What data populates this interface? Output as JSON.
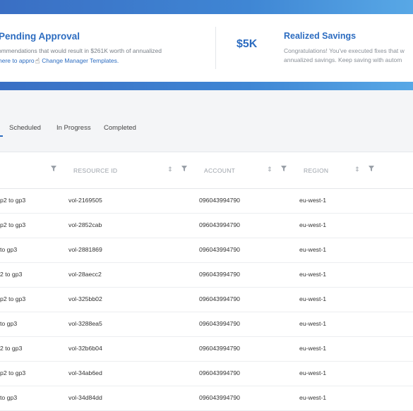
{
  "summary": {
    "pending": {
      "title": "Pending Approval",
      "description": "ommendations that would result in $261K worth of annualized",
      "link_prefix": "here to appro",
      "link_suffix": "Change Manager Templates."
    },
    "savings": {
      "value": "$5K",
      "title": "Realized Savings",
      "desc_line1": "Congratulations! You've executed fixes that w",
      "desc_line2": "annualized savings. Keep saving with autom"
    }
  },
  "tabs": [
    "Scheduled",
    "In Progress",
    "Completed"
  ],
  "table": {
    "headers": {
      "resource_id": "RESOURCE ID",
      "account": "ACCOUNT",
      "region": "REGION"
    },
    "rows": [
      {
        "action": "p2 to gp3",
        "resource": "vol-2169505",
        "account": "096043994790",
        "region": "eu-west-1"
      },
      {
        "action": "p2 to gp3",
        "resource": "vol-2852cab",
        "account": "096043994790",
        "region": "eu-west-1"
      },
      {
        "action": "to gp3",
        "resource": "vol-2881869",
        "account": "096043994790",
        "region": "eu-west-1"
      },
      {
        "action": "2 to gp3",
        "resource": "vol-28aecc2",
        "account": "096043994790",
        "region": "eu-west-1"
      },
      {
        "action": "p2 to gp3",
        "resource": "vol-325bb02",
        "account": "096043994790",
        "region": "eu-west-1"
      },
      {
        "action": "to gp3",
        "resource": "vol-3288ea5",
        "account": "096043994790",
        "region": "eu-west-1"
      },
      {
        "action": "2 to gp3",
        "resource": "vol-32b6b04",
        "account": "096043994790",
        "region": "eu-west-1"
      },
      {
        "action": "p2 to gp3",
        "resource": "vol-34ab6ed",
        "account": "096043994790",
        "region": "eu-west-1"
      },
      {
        "action": "to gp3",
        "resource": "vol-34d84dd",
        "account": "096043994790",
        "region": "eu-west-1"
      }
    ]
  }
}
